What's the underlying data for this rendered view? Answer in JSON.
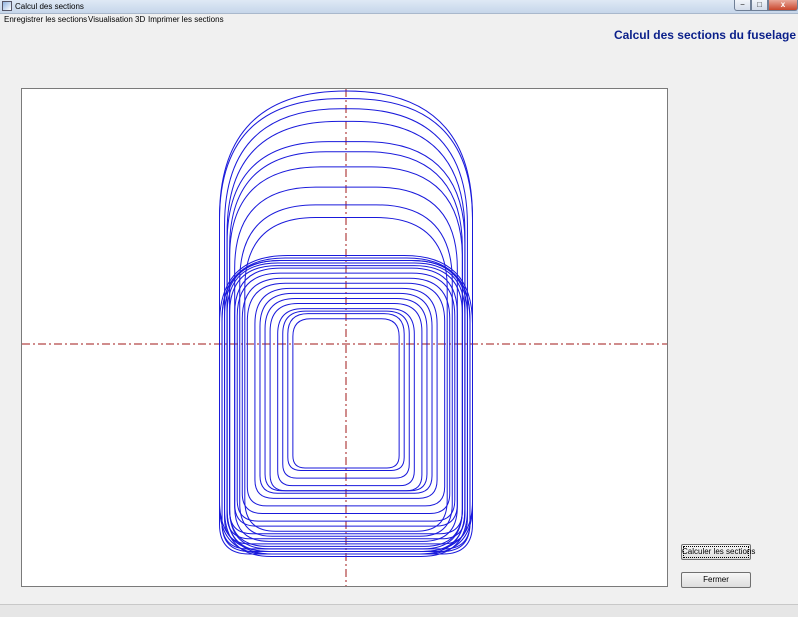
{
  "window": {
    "title": "Calcul des sections",
    "controls": {
      "minimize": "−",
      "maximize": "□",
      "close": "x"
    }
  },
  "menu": {
    "items": [
      {
        "label": "Enregistrer les sections"
      },
      {
        "label": "Visualisation 3D"
      },
      {
        "label": "Imprimer les sections"
      }
    ]
  },
  "header": {
    "title": "Calcul des sections du fuselage"
  },
  "drawing": {
    "line_color": "#1a1adb",
    "axis_color": "#a01818",
    "sections": [
      {
        "half_width": 0.5,
        "top": 1.0,
        "bottom": -0.82,
        "corner": 0.5
      },
      {
        "half_width": 0.5,
        "top": 0.97,
        "bottom": -0.83,
        "corner": 0.48
      },
      {
        "half_width": 0.48,
        "top": 0.93,
        "bottom": -0.84,
        "corner": 0.46
      },
      {
        "half_width": 0.47,
        "top": 0.88,
        "bottom": -0.83,
        "corner": 0.44
      },
      {
        "half_width": 0.47,
        "top": 0.8,
        "bottom": -0.82,
        "corner": 0.4
      },
      {
        "half_width": 0.46,
        "top": 0.76,
        "bottom": -0.81,
        "corner": 0.38
      },
      {
        "half_width": 0.46,
        "top": 0.7,
        "bottom": -0.8,
        "corner": 0.36
      },
      {
        "half_width": 0.44,
        "top": 0.62,
        "bottom": -0.78,
        "corner": 0.32
      },
      {
        "half_width": 0.42,
        "top": 0.55,
        "bottom": -0.76,
        "corner": 0.3
      },
      {
        "half_width": 0.4,
        "top": 0.5,
        "bottom": -0.74,
        "corner": 0.28
      },
      {
        "half_width": 0.5,
        "top": 0.35,
        "bottom": -0.83,
        "corner": 0.27
      },
      {
        "half_width": 0.49,
        "top": 0.34,
        "bottom": -0.82,
        "corner": 0.25
      },
      {
        "half_width": 0.49,
        "top": 0.33,
        "bottom": -0.81,
        "corner": 0.23
      },
      {
        "half_width": 0.48,
        "top": 0.33,
        "bottom": -0.79,
        "corner": 0.22
      },
      {
        "half_width": 0.47,
        "top": 0.32,
        "bottom": -0.77,
        "corner": 0.2
      },
      {
        "half_width": 0.46,
        "top": 0.31,
        "bottom": -0.75,
        "corner": 0.19
      },
      {
        "half_width": 0.44,
        "top": 0.3,
        "bottom": -0.72,
        "corner": 0.18
      },
      {
        "half_width": 0.43,
        "top": 0.28,
        "bottom": -0.7,
        "corner": 0.17
      },
      {
        "half_width": 0.41,
        "top": 0.26,
        "bottom": -0.67,
        "corner": 0.16
      },
      {
        "half_width": 0.39,
        "top": 0.24,
        "bottom": -0.64,
        "corner": 0.15
      },
      {
        "half_width": 0.36,
        "top": 0.22,
        "bottom": -0.61,
        "corner": 0.14
      },
      {
        "half_width": 0.34,
        "top": 0.2,
        "bottom": -0.59,
        "corner": 0.13
      },
      {
        "half_width": 0.32,
        "top": 0.18,
        "bottom": -0.58,
        "corner": 0.12
      },
      {
        "half_width": 0.3,
        "top": 0.16,
        "bottom": -0.58,
        "corner": 0.11
      },
      {
        "half_width": 0.27,
        "top": 0.14,
        "bottom": -0.56,
        "corner": 0.1
      },
      {
        "half_width": 0.25,
        "top": 0.13,
        "bottom": -0.53,
        "corner": 0.09
      },
      {
        "half_width": 0.23,
        "top": 0.12,
        "bottom": -0.5,
        "corner": 0.08
      },
      {
        "half_width": 0.21,
        "top": 0.1,
        "bottom": -0.49,
        "corner": 0.07
      }
    ]
  },
  "buttons": {
    "compute": "Calculer les sections",
    "close": "Fermer"
  }
}
